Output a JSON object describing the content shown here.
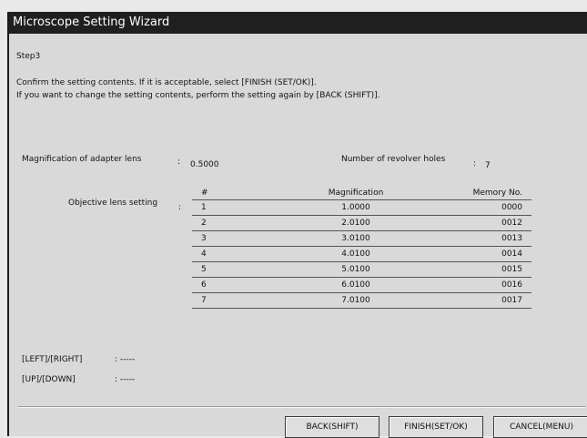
{
  "window": {
    "title": "Microscope Setting Wizard"
  },
  "step": "Step3",
  "instructions": [
    "Confirm the setting contents. If it is acceptable, select [FINISH (SET/OK)].",
    "If you want to change the setting contents, perform the setting again by [BACK (SHIFT)]."
  ],
  "adapter": {
    "label": "Magnification of adapter lens",
    "value": "0.5000"
  },
  "revolver": {
    "label": "Number of revolver holes",
    "value": "7"
  },
  "objective": {
    "label": "Objective lens setting",
    "headers": [
      "#",
      "Magnification",
      "Memory No."
    ],
    "rows": [
      [
        "1",
        "1.0000",
        "0000"
      ],
      [
        "2",
        "2.0100",
        "0012"
      ],
      [
        "3",
        "3.0100",
        "0013"
      ],
      [
        "4",
        "4.0100",
        "0014"
      ],
      [
        "5",
        "5.0100",
        "0015"
      ],
      [
        "6",
        "6.0100",
        "0016"
      ],
      [
        "7",
        "7.0100",
        "0017"
      ]
    ]
  },
  "keys": {
    "left_right": {
      "label": "[LEFT]/[RIGHT]",
      "value": ": -----"
    },
    "up_down": {
      "label": "[UP]/[DOWN]",
      "value": ": -----"
    }
  },
  "separator": ":",
  "buttons": {
    "back": "BACK(SHIFT)",
    "finish": "FINISH(SET/OK)",
    "cancel": "CANCEL(MENU)"
  }
}
